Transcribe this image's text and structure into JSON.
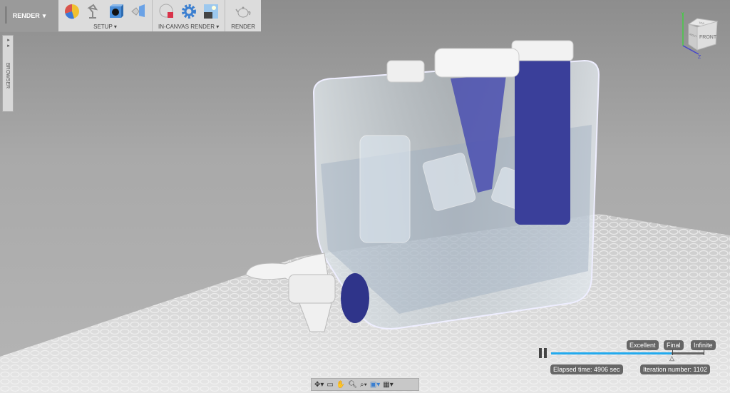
{
  "toolbar": {
    "workspace": "RENDER",
    "groups": [
      {
        "label": "SETUP",
        "icons": [
          "scene-settings-icon",
          "lamp-icon",
          "appearance-icon",
          "decal-icon"
        ]
      },
      {
        "label": "IN-CANVAS RENDER",
        "icons": [
          "in-canvas-render-icon",
          "render-settings-icon",
          "capture-image-icon"
        ]
      },
      {
        "label": "RENDER",
        "icons": [
          "teapot-render-icon"
        ]
      }
    ]
  },
  "browser": {
    "label": "BROWSER"
  },
  "viewcube": {
    "front": "FRONT",
    "right": "RIGHT",
    "top": "TOP",
    "axes": [
      "Y",
      "Z"
    ]
  },
  "render_progress": {
    "markers": [
      "Excellent",
      "Final",
      "Infinite"
    ],
    "progress": 0.79,
    "elapsed": "Elapsed time: 4906 sec",
    "iteration": "Iteration number: 1102",
    "accent": "#22aaee"
  },
  "nav_bar": {
    "icons": [
      "orbit-icon",
      "look-at-icon",
      "pan-icon",
      "zoom-icon",
      "fit-icon",
      "display-settings-icon",
      "visual-style-icon"
    ]
  }
}
